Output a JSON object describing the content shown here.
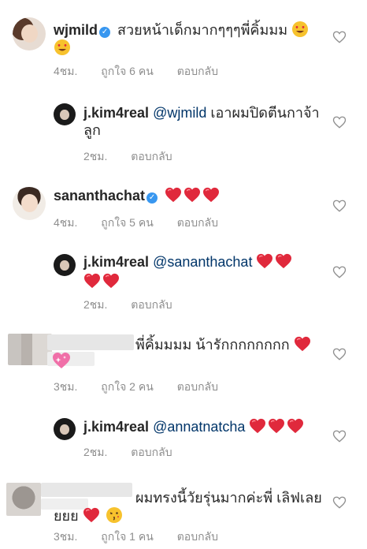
{
  "comments": [
    {
      "username": "wjmild",
      "verified": true,
      "text": "สวยหน้าเด็กมากๆๆๆพี่คิ้มมม",
      "time": "4ชม.",
      "likes": "ถูกใจ 6 คน",
      "reply": "ตอบกลับ"
    },
    {
      "username": "j.kim4real",
      "mention": "@wjmild",
      "text": "เอาผมปิดตีนกาจ้า",
      "text2": "ลูก",
      "time": "2ชม.",
      "reply": "ตอบกลับ"
    },
    {
      "username": "sananthachat",
      "verified": true,
      "time": "4ชม.",
      "likes": "ถูกใจ 5 คน",
      "reply": "ตอบกลับ"
    },
    {
      "username": "j.kim4real",
      "mention": "@sananthachat",
      "time": "2ชม.",
      "reply": "ตอบกลับ"
    },
    {
      "text": "พี่คิ้มมมม น้ารักกกกกกกก",
      "time": "3ชม.",
      "likes": "ถูกใจ 2 คน",
      "reply": "ตอบกลับ"
    },
    {
      "username": "j.kim4real",
      "mention": "@annatnatcha",
      "time": "2ชม.",
      "reply": "ตอบกลับ"
    },
    {
      "text": "ผมทรงนี้วัยรุ่นมากค่ะพี่ เลิฟเลย",
      "text2": "ยยย",
      "time": "3ชม.",
      "likes": "ถูกใจ 1 คน",
      "reply": "ตอบกลับ"
    }
  ],
  "icons": {
    "verified": "verified-badge-icon",
    "like": "heart-outline-icon",
    "red_heart": "red-heart-emoji",
    "sparkling_heart": "sparkling-heart-emoji",
    "heart_eyes": "heart-eyes-emoji",
    "kiss": "kissing-heart-emoji"
  },
  "colors": {
    "text": "#262626",
    "meta": "#8e8e8e",
    "mention": "#003569",
    "verified": "#3897f0",
    "heart": "#ed4956"
  }
}
